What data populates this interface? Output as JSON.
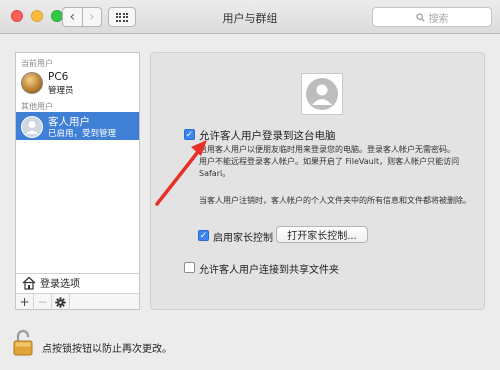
{
  "window": {
    "title": "用户与群组"
  },
  "search": {
    "placeholder": "搜索"
  },
  "sidebar": {
    "current_section": "当前用户",
    "other_section": "其他用户",
    "users": [
      {
        "name": "PC6",
        "role": "管理员"
      },
      {
        "name": "客人用户",
        "role": "已启用，受到管理"
      }
    ],
    "login_options": "登录选项",
    "add_symbol": "+",
    "remove_symbol": "−"
  },
  "panel": {
    "allow_login_label": "允许客人用户登录到这台电脑",
    "desc_line1": "启用客人用户以便朋友临时用来登录您的电脑。登录客人帐户无需密码。",
    "desc_line2": "用户不能远程登录客人帐户。如果开启了 FileVault，则客人帐户只能访问",
    "desc_line3": "Safari。",
    "logout_note": "当客人用户注销时，客人帐户的个人文件夹中的所有信息和文件都将被删除。",
    "parental_label": "启用家长控制",
    "open_parental_button": "打开家长控制...",
    "shared_folders_label": "允许客人用户连接到共享文件夹"
  },
  "footer": {
    "lock_text": "点按锁按钮以防止再次更改。"
  },
  "colors": {
    "selection": "#3f7fd6",
    "checkbox": "#3b86f1",
    "arrow": "#e8302a"
  }
}
